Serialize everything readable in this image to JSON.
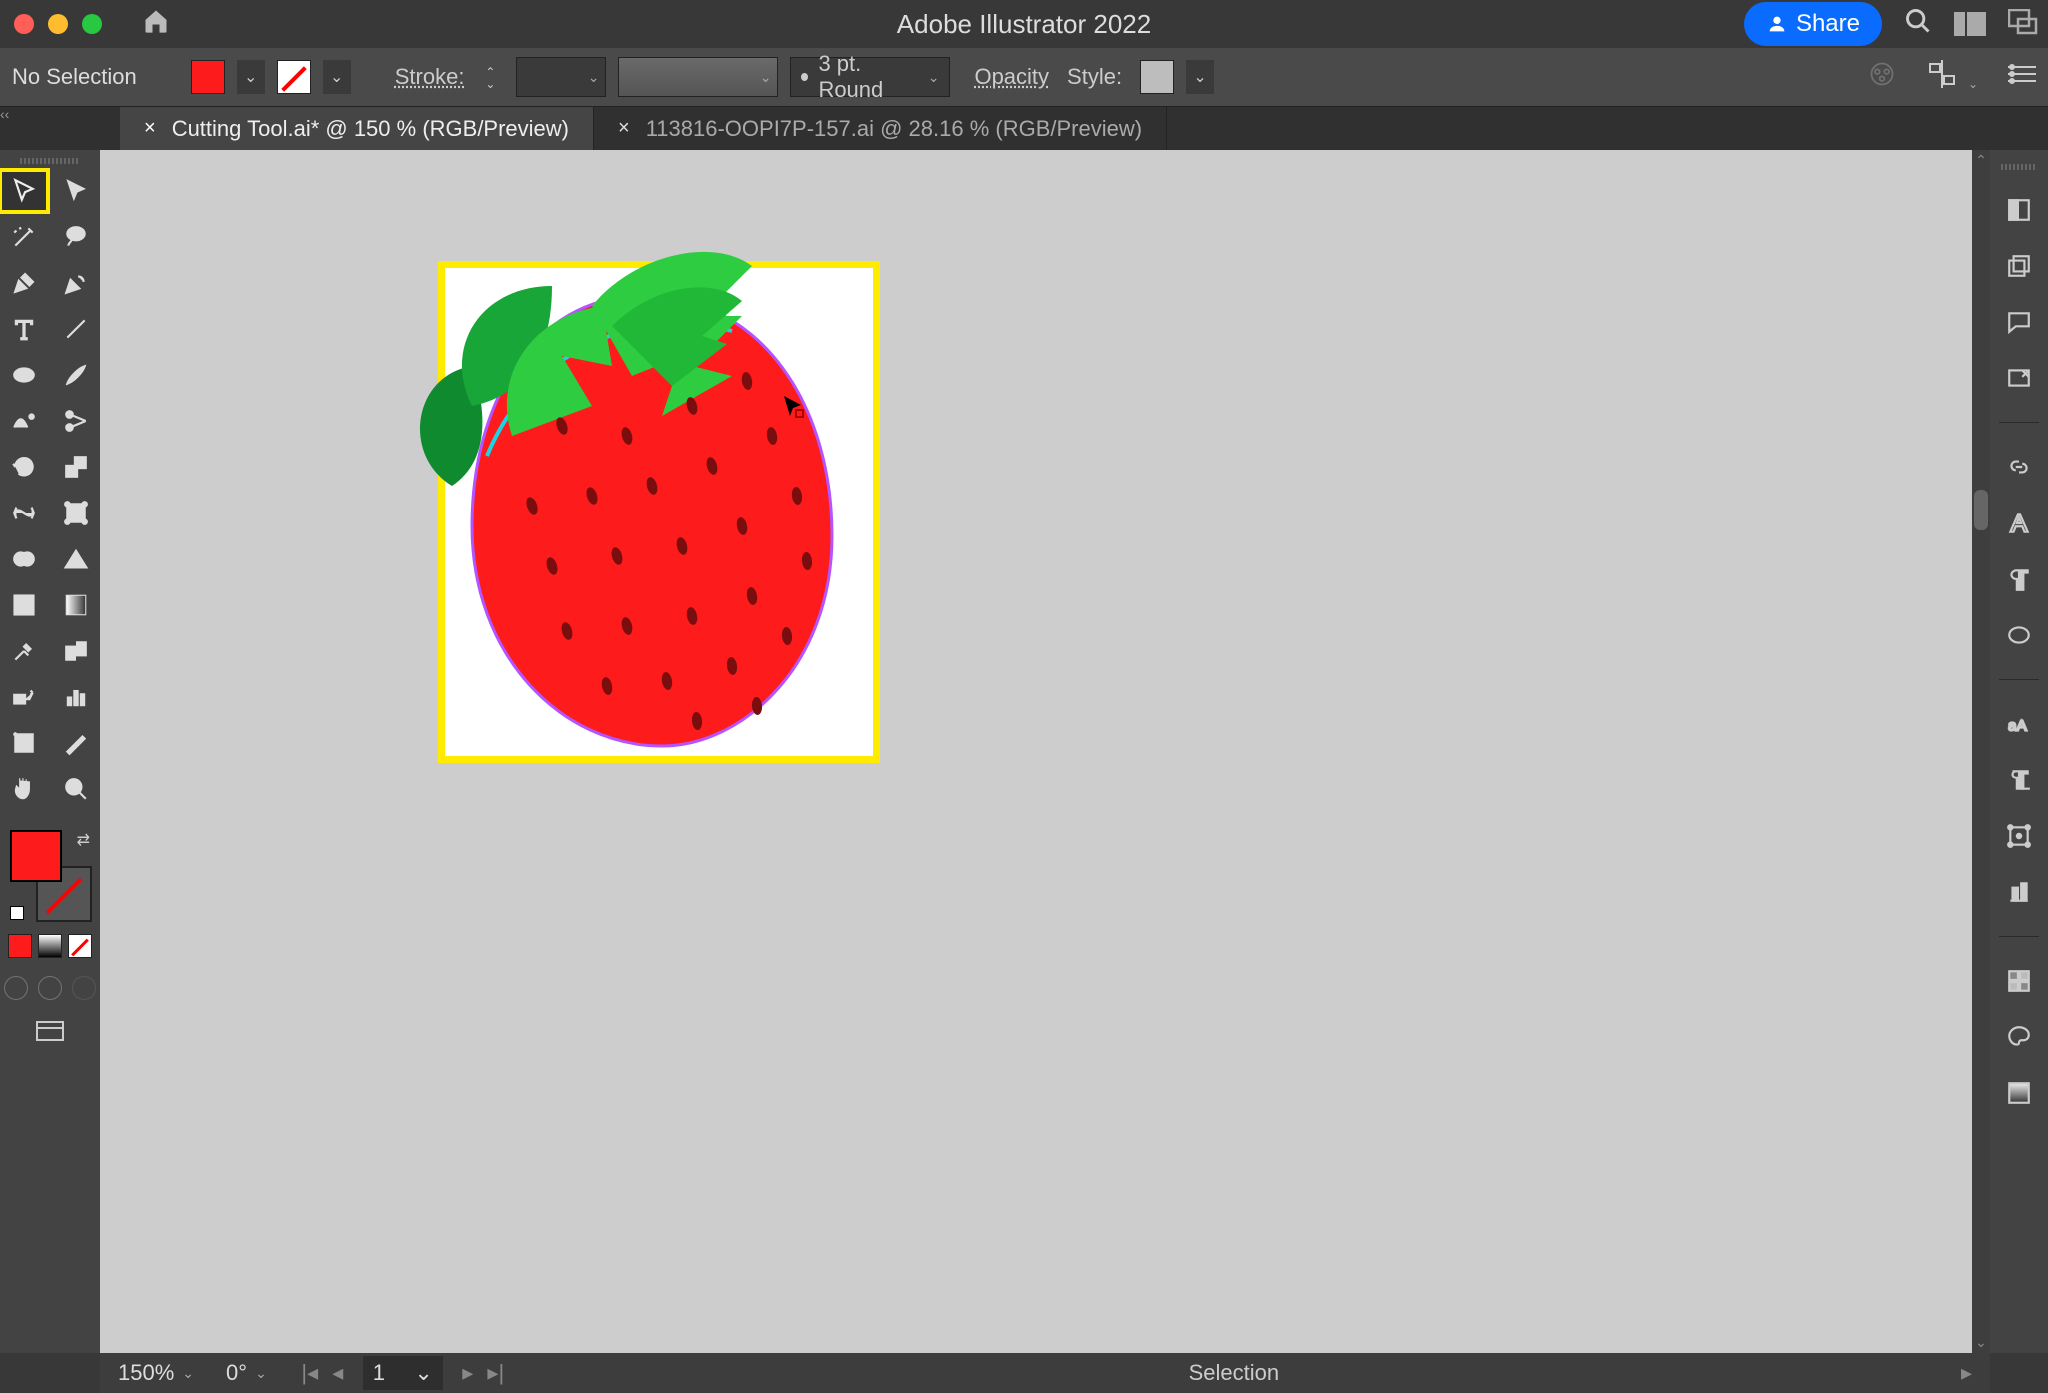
{
  "app_title": "Adobe Illustrator 2022",
  "share_label": "Share",
  "control": {
    "selection_label": "No Selection",
    "stroke_label": "Stroke:",
    "profile_label": "3 pt. Round",
    "opacity_label": "Opacity",
    "style_label": "Style:",
    "fill_color": "#fd1b1b"
  },
  "tabs": [
    {
      "label": "Cutting Tool.ai* @ 150 % (RGB/Preview)",
      "active": true
    },
    {
      "label": "113816-OOPI7P-157.ai @ 28.16 % (RGB/Preview)",
      "active": false
    }
  ],
  "status": {
    "zoom": "150%",
    "rotation": "0°",
    "artboard": "1",
    "tool": "Selection"
  },
  "colors": {
    "fill": "#fd1b1b",
    "highlight": "#ffeb00",
    "share_blue": "#0a6cff"
  },
  "artwork": {
    "description": "strawberry illustration",
    "selected": true
  }
}
